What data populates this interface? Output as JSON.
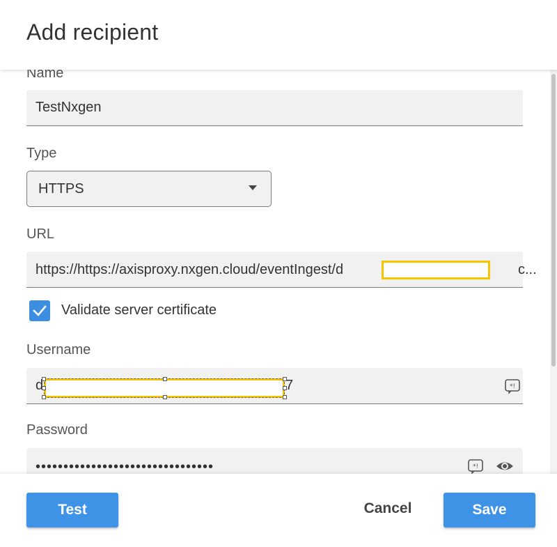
{
  "dialog": {
    "title": "Add recipient"
  },
  "form": {
    "name": {
      "label": "Name",
      "value": "TestNxgen"
    },
    "type": {
      "label": "Type",
      "value": "HTTPS"
    },
    "url": {
      "label": "URL",
      "value_start": "https://https://axisproxy.nxgen.cloud/eventIngest/d",
      "value_end": "c..."
    },
    "validate_certificate": {
      "label": "Validate server certificate",
      "checked": true
    },
    "username": {
      "label": "Username",
      "value_start": "d",
      "value_end": "7"
    },
    "password": {
      "label": "Password",
      "value": "••••••••••••••••••••••••••••••••"
    }
  },
  "footer": {
    "test_label": "Test",
    "cancel_label": "Cancel",
    "save_label": "Save"
  },
  "colors": {
    "accent": "#3e93e6",
    "redaction_border": "#f7c400"
  },
  "icons": {
    "select_caret": "chevron-down-icon",
    "username_keyboard": "special-chars-icon",
    "password_keyboard": "special-chars-icon",
    "password_visibility": "eye-icon",
    "checkbox": "checkmark-icon"
  }
}
